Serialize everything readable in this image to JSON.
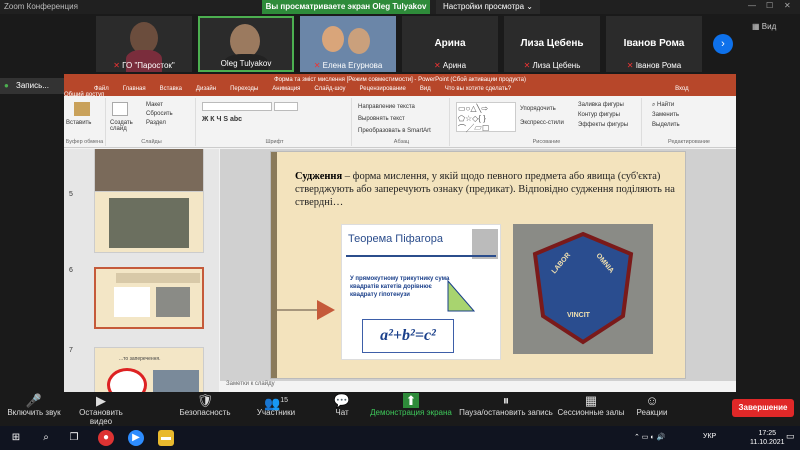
{
  "window": {
    "title": "Zoom Конференция"
  },
  "share_banner": {
    "text": "Вы просматриваете экран Oleg Tulyakov",
    "view_options": "Настройки просмотра"
  },
  "participants": [
    {
      "name": "ГО \"Паросток\"",
      "muted": true
    },
    {
      "name": "Oleg Tulyakov",
      "muted": false
    },
    {
      "name": "Елена Егурнова",
      "muted": true
    },
    {
      "name": "Арина",
      "name_label": "Арина",
      "muted": true
    },
    {
      "name": "Лиза Цебень",
      "name_label": "Лиза Цебень",
      "muted": true
    },
    {
      "name": "Іванов Рома",
      "name_label": "Іванов Рома",
      "muted": true
    }
  ],
  "view_label": "Вид",
  "record_label": "Запись...",
  "powerpoint": {
    "title": "Форма та зміст мислення [Режим совместимости] - PowerPoint (Сбой активации продукта)",
    "tabs": [
      "Файл",
      "Главная",
      "Вставка",
      "Дизайн",
      "Переходы",
      "Анимация",
      "Слайд-шоу",
      "Рецензирование",
      "Вид",
      "Что вы хотите сделать?",
      "Вход",
      "Общий доступ"
    ],
    "ribbon": {
      "groups": [
        "Буфер обмена",
        "Слайды",
        "Шрифт",
        "Абзац",
        "Рисование",
        "Редактирование"
      ],
      "insert": "Вставить",
      "create_slide": "Создать слайд",
      "arrange": "Упорядочить",
      "express_styles": "Экспресс-стили",
      "find": "Найти",
      "replace": "Заменить",
      "select": "Выделить",
      "layout": "Макет",
      "reset": "Сбросить",
      "section": "Раздел",
      "text_dir": "Направление текста",
      "align_text": "Выровнять текст",
      "smartart": "Преобразовать в SmartArt",
      "fill": "Заливка фигуры",
      "outline": "Контур фигуры",
      "effects": "Эффекты фигуры"
    },
    "thumbs": [
      {
        "num": "5"
      },
      {
        "num": "6"
      },
      {
        "num": "7"
      }
    ],
    "thumb7_text": "...то заперечення.",
    "slide": {
      "term": "Судження",
      "text": " – форма мислення, у якій щодо певного предмета або явища (суб'єкта) стверджують або заперечують  ознаку (предикат). Відповідно судження поділяють на стверднi…",
      "pythagoras_title": "Теорема Піфагора",
      "pythagoras_bullet": "У прямокутному трикутнику сума квадратів катетів дорівнює квадрату гіпотенузи",
      "formula": "a²+b²=c²",
      "mosaic_words": [
        "LABOR",
        "OMNIA",
        "VINCIT"
      ]
    },
    "notes": "Заметки к слайду"
  },
  "controls": [
    {
      "label": "Включить звук",
      "icon": "🎤"
    },
    {
      "label": "Остановить видео",
      "icon": "▶"
    },
    {
      "label": "Безопасность",
      "icon": "🛡"
    },
    {
      "label": "Участники",
      "icon": "👥",
      "count": "15"
    },
    {
      "label": "Чат",
      "icon": "💬"
    },
    {
      "label": "Демонстрация экрана",
      "icon": "⬆"
    },
    {
      "label": "Пауза/остановить запись",
      "icon": "⏸"
    },
    {
      "label": "Сессионные залы",
      "icon": "▦"
    },
    {
      "label": "Реакции",
      "icon": "☺"
    }
  ],
  "leave_button": "Завершение",
  "taskbar": {
    "time": "17:25",
    "date": "11.10.2021",
    "lang": "УКР"
  },
  "colors": {
    "zoom_blue": "#0e71eb",
    "share_green": "#2e8b3a",
    "ppt_orange": "#b7472a",
    "leave_red": "#e02828"
  }
}
